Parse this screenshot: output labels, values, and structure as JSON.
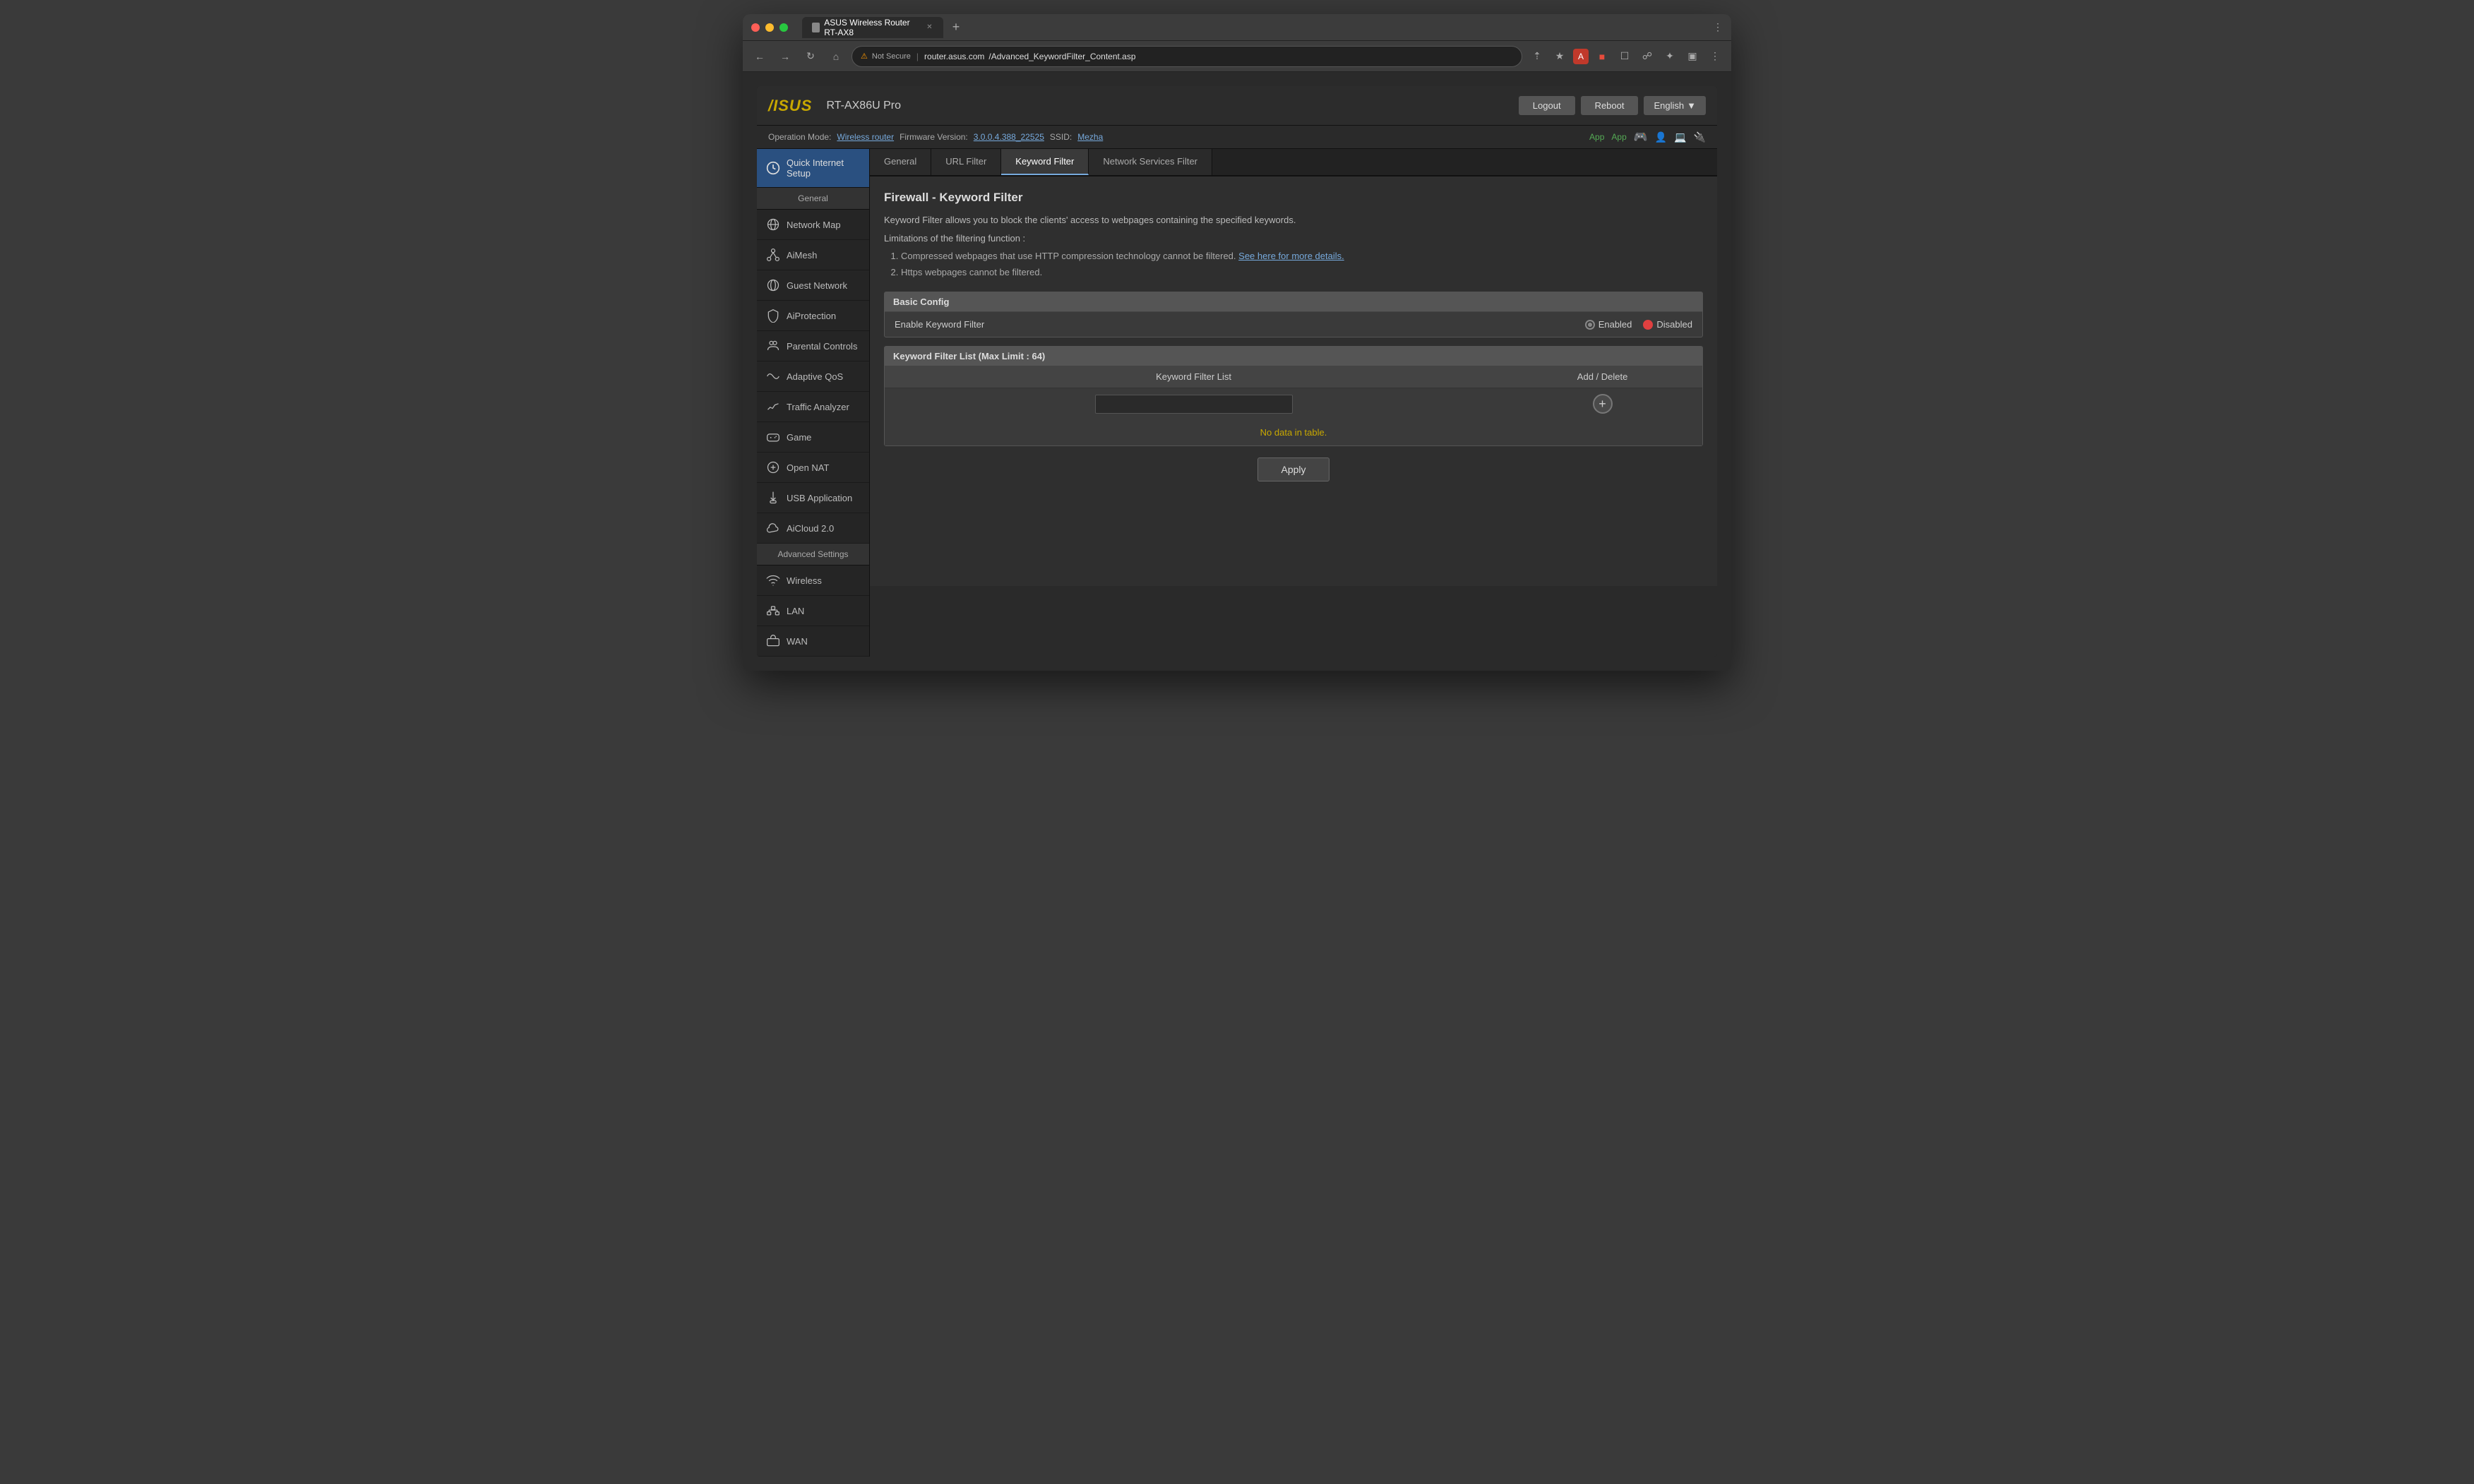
{
  "browser": {
    "tab_title": "ASUS Wireless Router RT-AX8",
    "tab_favicon": "router",
    "url_protocol": "Not Secure",
    "url_host": "router.asus.com",
    "url_path": "/Advanced_KeywordFilter_Content.asp"
  },
  "router": {
    "logo_text": "/ISUS",
    "model": "RT-AX86U Pro",
    "nav": {
      "logout_label": "Logout",
      "reboot_label": "Reboot",
      "language_label": "English"
    },
    "status": {
      "operation_mode_label": "Operation Mode:",
      "operation_mode_value": "Wireless router",
      "firmware_label": "Firmware Version:",
      "firmware_value": "3.0.0.4.388_22525",
      "ssid_label": "SSID:",
      "ssid_value": "Mezha",
      "app_label": "App"
    },
    "sidebar": {
      "general_header": "General",
      "quick_setup_label": "Quick Internet Setup",
      "items": [
        {
          "id": "network-map",
          "label": "Network Map",
          "icon": "globe"
        },
        {
          "id": "aimesh",
          "label": "AiMesh",
          "icon": "aimesh"
        },
        {
          "id": "guest-network",
          "label": "Guest Network",
          "icon": "guest"
        },
        {
          "id": "aiprotection",
          "label": "AiProtection",
          "icon": "shield"
        },
        {
          "id": "parental-controls",
          "label": "Parental Controls",
          "icon": "parental"
        },
        {
          "id": "adaptive-qos",
          "label": "Adaptive QoS",
          "icon": "qos"
        },
        {
          "id": "traffic-analyzer",
          "label": "Traffic Analyzer",
          "icon": "traffic"
        },
        {
          "id": "game",
          "label": "Game",
          "icon": "game"
        },
        {
          "id": "open-nat",
          "label": "Open NAT",
          "icon": "nat"
        },
        {
          "id": "usb-application",
          "label": "USB Application",
          "icon": "usb"
        },
        {
          "id": "aicloud",
          "label": "AiCloud 2.0",
          "icon": "cloud"
        }
      ],
      "advanced_header": "Advanced Settings",
      "advanced_items": [
        {
          "id": "wireless",
          "label": "Wireless",
          "icon": "wireless"
        },
        {
          "id": "lan",
          "label": "LAN",
          "icon": "lan"
        },
        {
          "id": "wan",
          "label": "WAN",
          "icon": "wan"
        }
      ]
    },
    "tabs": [
      {
        "id": "general",
        "label": "General"
      },
      {
        "id": "url-filter",
        "label": "URL Filter"
      },
      {
        "id": "keyword-filter",
        "label": "Keyword Filter",
        "active": true
      },
      {
        "id": "network-services-filter",
        "label": "Network Services Filter"
      }
    ],
    "page": {
      "title": "Firewall - Keyword Filter",
      "description": "Keyword Filter allows you to block the clients' access to webpages containing the specified keywords.",
      "limitations_header": "Limitations of the filtering function :",
      "limitation_1": "Compressed webpages that use HTTP compression technology cannot be filtered.",
      "limitation_1_link": "See here for more details.",
      "limitation_2": "Https webpages cannot be filtered.",
      "basic_config_header": "Basic Config",
      "enable_label": "Enable Keyword Filter",
      "enabled_label": "Enabled",
      "disabled_label": "Disabled",
      "filter_list_header": "Keyword Filter List (Max Limit : 64)",
      "col_filter_list": "Keyword Filter List",
      "col_add_delete": "Add / Delete",
      "no_data_text": "No data in table.",
      "apply_label": "Apply"
    }
  }
}
